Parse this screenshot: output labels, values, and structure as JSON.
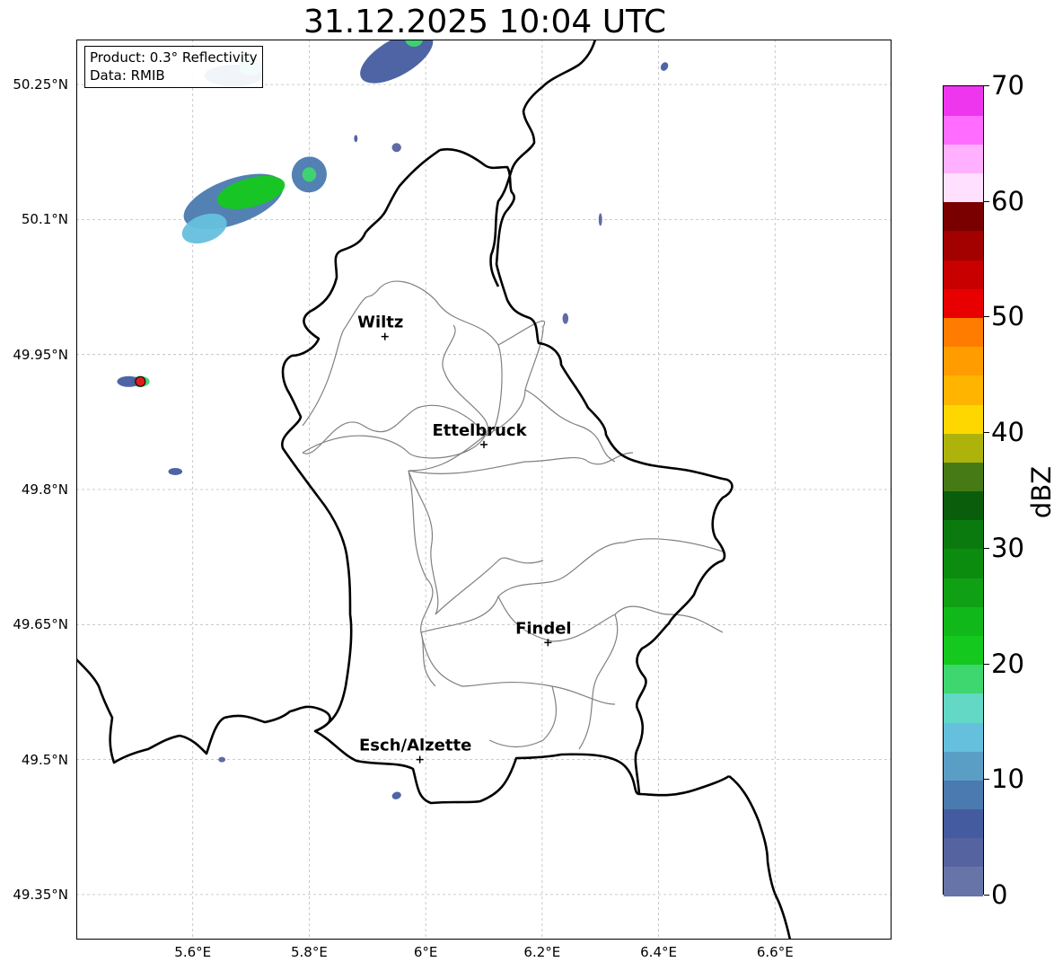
{
  "title": "31.12.2025 10:04 UTC",
  "info": {
    "product": "Product: 0.3° Reflectivity",
    "data_source": "Data: RMIB"
  },
  "map": {
    "lon_range": [
      5.4,
      6.8
    ],
    "lat_range": [
      49.3,
      50.3
    ],
    "lat_ticks": [
      {
        "value": 50.25,
        "label": "50.25°N"
      },
      {
        "value": 50.1,
        "label": "50.1°N"
      },
      {
        "value": 49.95,
        "label": "49.95°N"
      },
      {
        "value": 49.8,
        "label": "49.8°N"
      },
      {
        "value": 49.65,
        "label": "49.65°N"
      },
      {
        "value": 49.5,
        "label": "49.5°N"
      },
      {
        "value": 49.35,
        "label": "49.35°N"
      }
    ],
    "lon_ticks": [
      {
        "value": 5.6,
        "label": "5.6°E"
      },
      {
        "value": 5.8,
        "label": "5.8°E"
      },
      {
        "value": 6.0,
        "label": "6°E"
      },
      {
        "value": 6.2,
        "label": "6.2°E"
      },
      {
        "value": 6.4,
        "label": "6.4°E"
      },
      {
        "value": 6.6,
        "label": "6.6°E"
      }
    ],
    "grid": true,
    "cities": [
      {
        "name": "Wiltz",
        "lon": 5.93,
        "lat": 49.97
      },
      {
        "name": "Ettelbruck",
        "lon": 6.1,
        "lat": 49.85
      },
      {
        "name": "Findel",
        "lon": 6.21,
        "lat": 49.63
      },
      {
        "name": "Esch/Alzette",
        "lon": 5.99,
        "lat": 49.5
      }
    ],
    "radar_site": {
      "lon": 5.51,
      "lat": 49.92,
      "color": "#e31a1c"
    },
    "echoes": [
      {
        "lon": 5.67,
        "lat": 50.12,
        "rx": 0.09,
        "ry": 0.025,
        "rot": -20,
        "dbz": 8
      },
      {
        "lon": 5.7,
        "lat": 50.13,
        "rx": 0.06,
        "ry": 0.016,
        "rot": -15,
        "dbz": 22
      },
      {
        "lon": 5.62,
        "lat": 50.09,
        "rx": 0.04,
        "ry": 0.015,
        "rot": -20,
        "dbz": 14
      },
      {
        "lon": 5.8,
        "lat": 50.15,
        "rx": 0.03,
        "ry": 0.02,
        "rot": 20,
        "dbz": 8
      },
      {
        "lon": 5.8,
        "lat": 50.15,
        "rx": 0.012,
        "ry": 0.008,
        "rot": 0,
        "dbz": 18
      },
      {
        "lon": 5.67,
        "lat": 50.26,
        "rx": 0.05,
        "ry": 0.012,
        "rot": 0,
        "dbz": 8
      },
      {
        "lon": 5.7,
        "lat": 50.27,
        "rx": 0.02,
        "ry": 0.01,
        "rot": 0,
        "dbz": 15
      },
      {
        "lon": 5.95,
        "lat": 50.28,
        "rx": 0.07,
        "ry": 0.02,
        "rot": -30,
        "dbz": 6
      },
      {
        "lon": 5.98,
        "lat": 50.3,
        "rx": 0.015,
        "ry": 0.008,
        "rot": 0,
        "dbz": 19
      },
      {
        "lon": 5.51,
        "lat": 49.92,
        "rx": 0.016,
        "ry": 0.006,
        "rot": 0,
        "dbz": 18
      },
      {
        "lon": 5.49,
        "lat": 49.92,
        "rx": 0.02,
        "ry": 0.006,
        "rot": 0,
        "dbz": 6
      },
      {
        "lon": 5.57,
        "lat": 49.82,
        "rx": 0.012,
        "ry": 0.004,
        "rot": 0,
        "dbz": 5
      },
      {
        "lon": 5.88,
        "lat": 50.19,
        "rx": 0.003,
        "ry": 0.004,
        "rot": 0,
        "dbz": 6
      },
      {
        "lon": 5.95,
        "lat": 50.18,
        "rx": 0.008,
        "ry": 0.005,
        "rot": 0,
        "dbz": 4
      },
      {
        "lon": 6.41,
        "lat": 50.27,
        "rx": 0.006,
        "ry": 0.005,
        "rot": 30,
        "dbz": 5
      },
      {
        "lon": 6.24,
        "lat": 49.99,
        "rx": 0.005,
        "ry": 0.006,
        "rot": 0,
        "dbz": 4
      },
      {
        "lon": 6.3,
        "lat": 50.1,
        "rx": 0.003,
        "ry": 0.007,
        "rot": 0,
        "dbz": 4
      },
      {
        "lon": 5.95,
        "lat": 49.46,
        "rx": 0.008,
        "ry": 0.004,
        "rot": -20,
        "dbz": 5
      },
      {
        "lon": 5.65,
        "lat": 49.5,
        "rx": 0.006,
        "ry": 0.003,
        "rot": 0,
        "dbz": 4
      }
    ]
  },
  "colorbar": {
    "label": "dBZ",
    "min": 0,
    "max": 70,
    "step": 2.5,
    "ticks": [
      {
        "value": 0,
        "label": "0"
      },
      {
        "value": 10,
        "label": "10"
      },
      {
        "value": 20,
        "label": "20"
      },
      {
        "value": 30,
        "label": "30"
      },
      {
        "value": 40,
        "label": "40"
      },
      {
        "value": 50,
        "label": "50"
      },
      {
        "value": 60,
        "label": "60"
      },
      {
        "value": 70,
        "label": "70"
      }
    ],
    "colors": [
      "#6674a7",
      "#5563a0",
      "#445c9f",
      "#4a7aaf",
      "#5a9ec6",
      "#65c0dd",
      "#62d8c5",
      "#3ed66f",
      "#14c81e",
      "#11b81a",
      "#0fa014",
      "#0c8c0f",
      "#0b7a0e",
      "#0a5e0b",
      "#457a14",
      "#adb30b",
      "#ffd700",
      "#ffb400",
      "#ff9c00",
      "#ff7c00",
      "#e80000",
      "#c80000",
      "#a30000",
      "#7a0000",
      "#ffe0ff",
      "#ffb0ff",
      "#ff6cff",
      "#ee36ee"
    ]
  }
}
